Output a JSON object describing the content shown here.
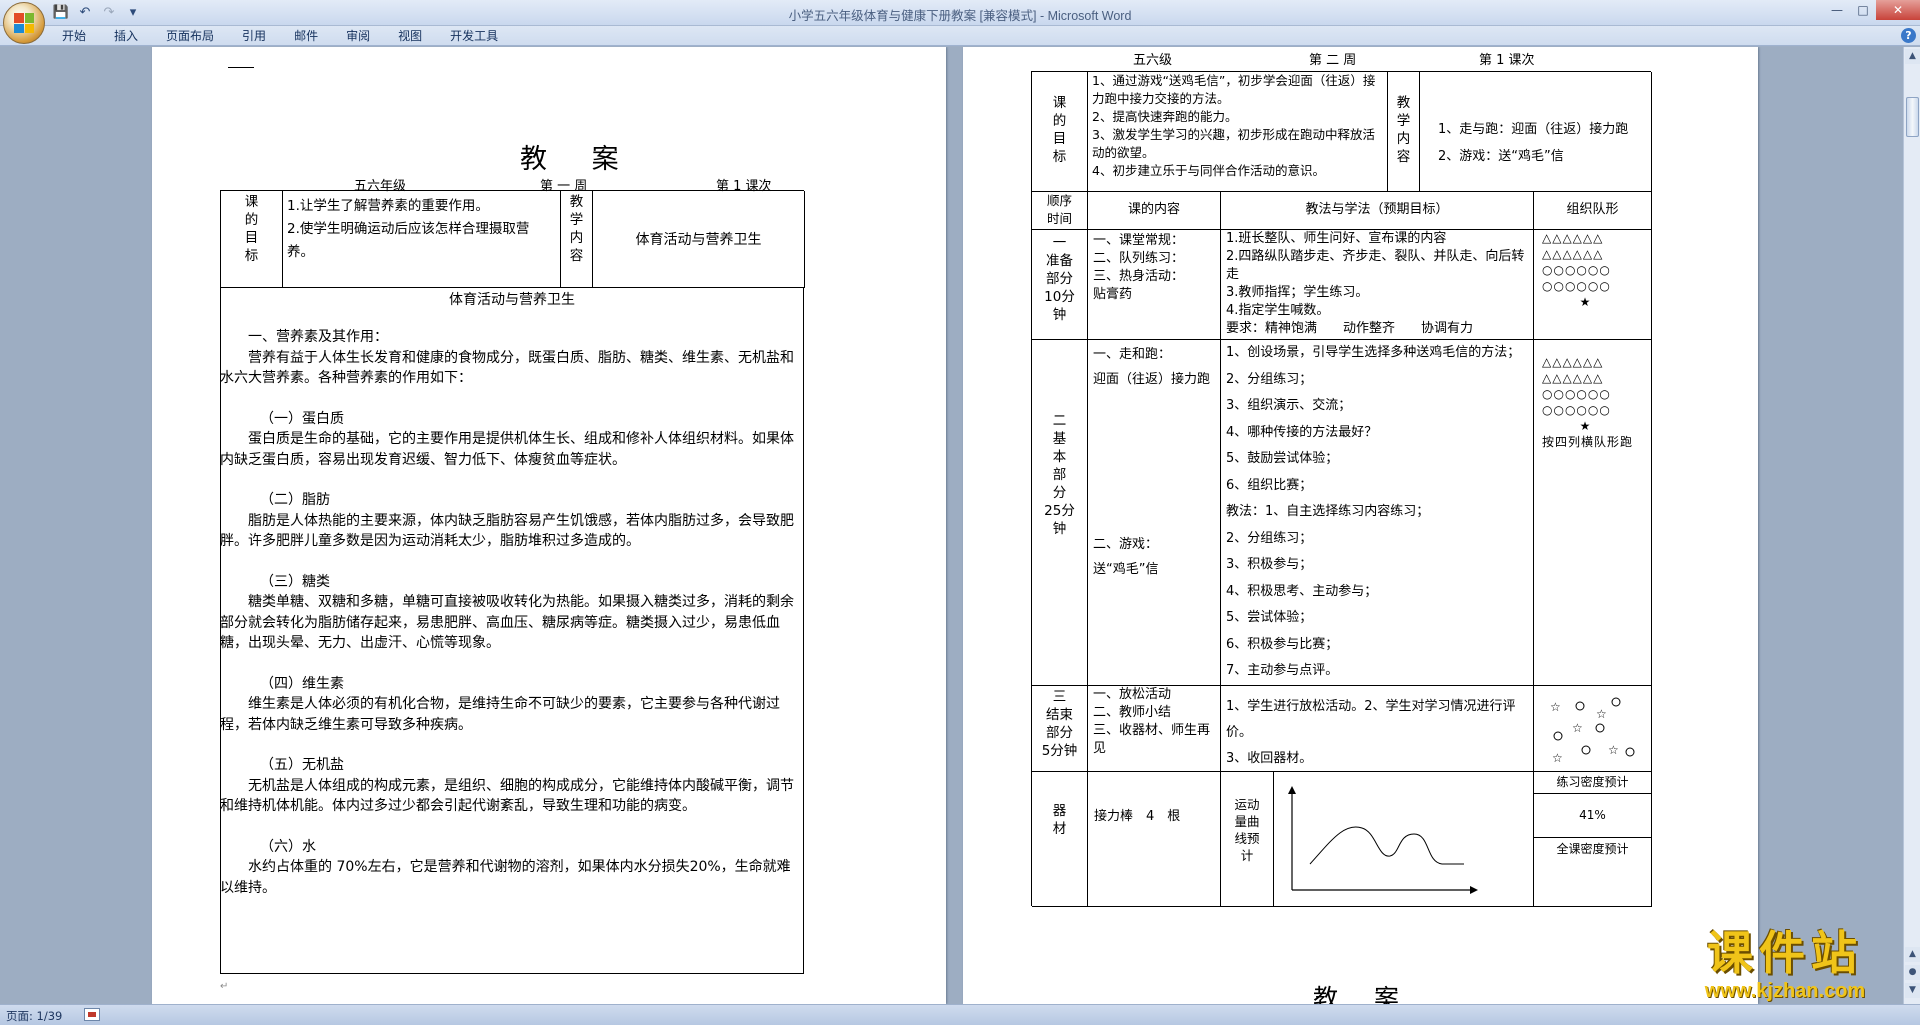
{
  "app": {
    "window_title": "小学五六年级体育与健康下册教案 [兼容模式] - Microsoft Word",
    "ribbon_tabs": [
      "开始",
      "插入",
      "页面布局",
      "引用",
      "邮件",
      "审阅",
      "视图",
      "开发工具"
    ],
    "qat": {
      "save_icon": "save-icon",
      "undo_icon": "undo-icon",
      "redo_icon": "redo-icon",
      "more_icon": "customize-icon"
    },
    "help": "?",
    "status": {
      "page": "页面: 1/39"
    }
  },
  "left_page": {
    "doc_title": "教 案",
    "header": {
      "grade": "五六年级",
      "week": "第 一 周",
      "lesson": "第 1 课次"
    },
    "table": {
      "goal_label": "课\n的\n目\n标",
      "goal_1": "1.让学生了解营养素的重要作用。",
      "goal_2": "2.使学生明确运动后应该怎样合理摄取营养。",
      "content_label": "教\n学\n内\n容",
      "content": "体育活动与营养卫生"
    },
    "body_title": "体育活动与营养卫生",
    "sections": [
      {
        "heading": "一、营养素及其作用：",
        "text": "营养有益于人体生长发育和健康的食物成分，既蛋白质、脂肪、糖类、维生素、无机盐和水六大营养素。各种营养素的作用如下："
      },
      {
        "heading": "（一）蛋白质",
        "text": "蛋白质是生命的基础，它的主要作用是提供机体生长、组成和修补人体组织材料。如果体内缺乏蛋白质，容易出现发育迟缓、智力低下、体瘦贫血等症状。"
      },
      {
        "heading": "（二）脂肪",
        "text": "脂肪是人体热能的主要来源，体内缺乏脂肪容易产生饥饿感，若体内脂肪过多，会导致肥胖。许多肥胖儿童多数是因为运动消耗太少，脂肪堆积过多造成的。"
      },
      {
        "heading": "（三）糖类",
        "text": "糖类单糖、双糖和多糖，单糖可直接被吸收转化为热能。如果摄入糖类过多，消耗的剩余部分就会转化为脂肪储存起来，易患肥胖、高血压、糖尿病等症。糖类摄入过少，易患低血糖，出现头晕、无力、出虚汗、心慌等现象。"
      },
      {
        "heading": "（四）维生素",
        "text": "维生素是人体必须的有机化合物，是维持生命不可缺少的要素，它主要参与各种代谢过程，若体内缺乏维生素可导致多种疾病。"
      },
      {
        "heading": "（五）无机盐",
        "text": "无机盐是人体组成的构成元素，是组织、细胞的构成成分，它能维持体内酸碱平衡，调节和维持机体机能。体内过多过少都会引起代谢紊乱，导致生理和功能的病变。"
      },
      {
        "heading": "（六）水",
        "text": "水约占体重的 70%左右，它是营养和代谢物的溶剂，如果体内水分损失20%，生命就难以维持。"
      }
    ]
  },
  "right_page": {
    "header": {
      "grade": "五六级",
      "week": "第 二 周",
      "lesson": "第 1 课次"
    },
    "goal_label": "课\n的\n目\n标",
    "goals": [
      "1、通过游戏“送鸡毛信”，初步学会迎面（往返）接力跑中接力交接的方法。",
      "2、提高快速奔跑的能力。",
      "3、激发学生学习的兴趣，初步形成在跑动中释放活动的欲望。",
      "4、初步建立乐于与同伴合作活动的意识。"
    ],
    "content_label": "教\n学\n内\n容",
    "contents": [
      "1、走与跑：迎面（往返）接力跑",
      "2、游戏：送“鸡毛”信"
    ],
    "col_headers": [
      "顺序\n时间",
      "课的内容",
      "教法与学法（预期目标）",
      "组织队形"
    ],
    "part1": {
      "label": "一\n准备\n部分\n10分\n钟",
      "content": [
        "一、课堂常规：",
        "二、队列练习：",
        "三、热身活动：",
        "贴膏药"
      ],
      "methods": [
        "1.班长整队、师生问好、宣布课的内容",
        "2.四路纵队踏步走、齐步走、裂队、并队走、向后转走",
        "3.教师指挥；学生练习。",
        "4.指定学生喊数。",
        "要求：精神饱满　　动作整齐　　协调有力"
      ],
      "formation": [
        "△△△△△△",
        "△△△△△△",
        "○○○○○○",
        "○○○○○○",
        "★"
      ]
    },
    "part2": {
      "label": "二\n基\n本\n部\n分\n25分\n钟",
      "content": [
        "一、走和跑：",
        "迎面（往返）接力跑",
        "二、游戏：",
        "送“鸡毛”信"
      ],
      "methods": [
        "1、创设场景，引导学生选择多种送鸡毛信的方法；",
        "2、分组练习；",
        "3、组织演示、交流；",
        "4、哪种传接的方法最好？",
        "5、鼓励尝试体验；",
        "6、组织比赛；",
        "教法：1、自主选择练习内容练习；",
        "2、分组练习；",
        "3、积极参与；",
        "4、积极思考、主动参与；",
        "5、尝试体验；",
        "6、积极参与比赛；",
        "7、主动参与点评。"
      ],
      "formation": [
        "△△△△△△",
        "△△△△△△",
        "○○○○○○",
        "○○○○○○",
        "★",
        "按四列横队形跑"
      ]
    },
    "part3": {
      "label": "三\n结束\n部分\n5分钟",
      "content": [
        "一、放松活动",
        "二、教师小结",
        "三、收器材、师生再见"
      ],
      "methods": [
        "1、学生进行放松活动。2、学生对学习情况进行评价。",
        "3、收回器材。"
      ]
    },
    "equipment": {
      "label": "器\n材",
      "items": "接力棒　4　根",
      "curve_label": "运动\n量曲\n线预\n计",
      "density_label": "练习密度预计",
      "density_value": "41%",
      "total_density_label": "全课密度预计"
    },
    "next_title": "教 案"
  },
  "watermark": {
    "text": "课件站",
    "url": "www.kjzhan.com"
  },
  "colors": {
    "ribbon": "#dde7f4",
    "workspace": "#9dadc2",
    "watermark": "#f0c419"
  }
}
